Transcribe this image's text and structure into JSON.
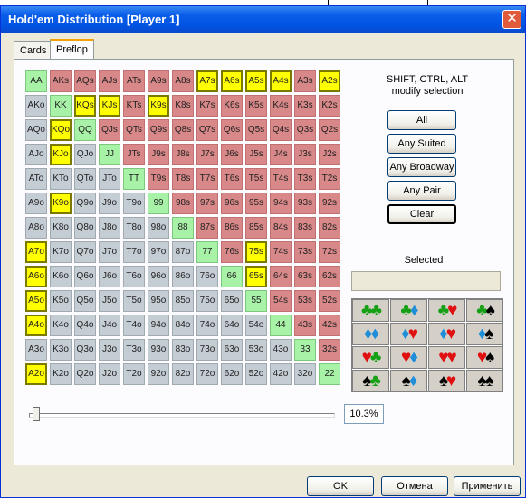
{
  "window": {
    "title": "Hold'em Distribution [Player 1]"
  },
  "tabs": [
    {
      "label": "Cards"
    },
    {
      "label": "Preflop"
    }
  ],
  "hint": {
    "line1": "SHIFT, CTRL, ALT",
    "line2": "modify selection"
  },
  "buttons": {
    "all": "All",
    "any_suited": "Any Suited",
    "any_broadway": "Any Broadway",
    "any_pair": "Any Pair",
    "clear": "Clear"
  },
  "selected": {
    "label": "Selected",
    "value": ""
  },
  "slider": {
    "percent": "10.3%",
    "position_fraction": 0.0
  },
  "footer": {
    "ok": "OK",
    "cancel": "Отмена",
    "apply": "Применить"
  },
  "colors": {
    "suited": "#d88888",
    "offsuit": "#c4ccd4",
    "pair": "#a8f2a8",
    "selected": "#ffff00",
    "title_bar": "#0054e3"
  },
  "ranks": [
    "A",
    "K",
    "Q",
    "J",
    "T",
    "9",
    "8",
    "7",
    "6",
    "5",
    "4",
    "3",
    "2"
  ],
  "selected_hands": [
    "A7s",
    "A6s",
    "A5s",
    "A4s",
    "A2s",
    "KQs",
    "KJs",
    "K9s",
    "KQo",
    "KJo",
    "K9o",
    "75s",
    "65s",
    "A7o",
    "A6o",
    "A5o",
    "A4o",
    "A2o"
  ],
  "suit_grid": [
    [
      [
        "club",
        "club"
      ],
      [
        "club",
        "diamond"
      ],
      [
        "club",
        "heart"
      ],
      [
        "club",
        "spade"
      ]
    ],
    [
      [
        "diamond",
        "diamond"
      ],
      [
        "diamond",
        "heart"
      ],
      [
        "diamond",
        "heart"
      ],
      [
        "diamond",
        "spade"
      ]
    ],
    [
      [
        "heart",
        "club"
      ],
      [
        "heart",
        "diamond"
      ],
      [
        "heart",
        "heart"
      ],
      [
        "heart",
        "spade"
      ]
    ],
    [
      [
        "spade",
        "club"
      ],
      [
        "spade",
        "diamond"
      ],
      [
        "spade",
        "heart"
      ],
      [
        "spade",
        "spade"
      ]
    ]
  ]
}
